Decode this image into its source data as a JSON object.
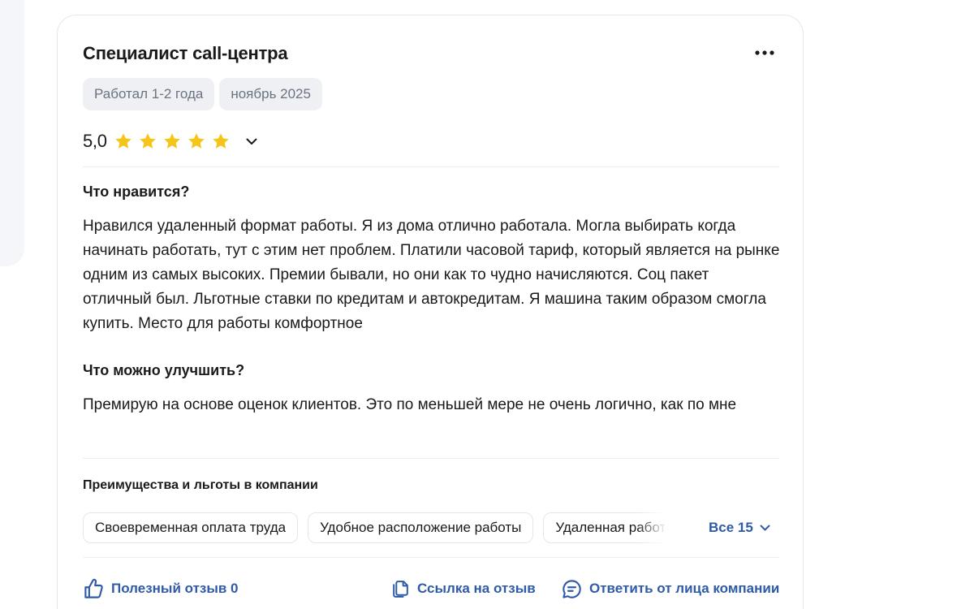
{
  "review": {
    "job_title": "Специалист call-центра",
    "tags": [
      "Работал 1-2 года",
      "ноябрь 2025"
    ],
    "rating": {
      "value": "5,0",
      "stars_filled": 5,
      "stars_total": 5,
      "star_color": "#f5c518"
    },
    "likes": {
      "heading": "Что нравится?",
      "text": "Нравился удаленный формат работы. Я из дома отлично работала. Могла выбирать когда начинать работать, тут с этим нет проблем. Платили часовой тариф, который является на рынке одним из самых высоких. Премии бывали, но они как то чудно начисляются. Соц пакет отличный был. Льготные ставки по кредитам и автокредитам. Я машина таким образом смогла купить. Место для работы комфортное"
    },
    "improve": {
      "heading": "Что можно улучшить?",
      "text": "Премирую на основе оценок клиентов. Это по меньшей мере не очень логично, как по мне"
    },
    "benefits": {
      "heading": "Преимущества и льготы в компании",
      "items": [
        "Своевременная оплата труда",
        "Удобное расположение работы",
        "Удаленная работа"
      ],
      "all_label": "Все 15"
    },
    "actions": {
      "helpful_label": "Полезный отзыв 0",
      "link_label": "Ссылка на отзыв",
      "reply_label": "Ответить от лица компании"
    }
  },
  "colors": {
    "accent": "#2f5aa8",
    "chip_bg": "#eef0f4",
    "border": "#e3e6ec"
  },
  "icons": {
    "more": "more-dots-icon",
    "expand": "chevron-down-icon",
    "helpful": "thumbs-up-icon",
    "link": "copy-link-icon",
    "reply": "chat-reply-icon"
  }
}
